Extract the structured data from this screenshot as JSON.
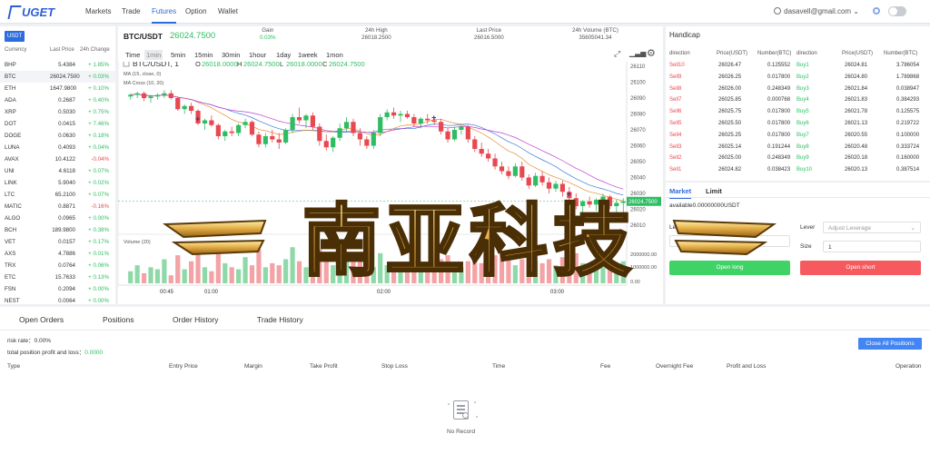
{
  "header": {
    "logo_text": "UGET",
    "nav": [
      "Markets",
      "Trade",
      "Futures",
      "Option",
      "Wallet"
    ],
    "active_nav": "Futures",
    "user_email": "dasavell@gmail.com"
  },
  "markets": {
    "tab": "USDT",
    "col_currency": "Currency",
    "col_last": "Last Price",
    "col_change": "24h Change",
    "rows": [
      {
        "currency": "BHP",
        "last": "5.4384",
        "change": "+ 1.85%",
        "dir": "up"
      },
      {
        "currency": "BTC",
        "last": "26024.7500",
        "change": "+ 0.03%",
        "dir": "up"
      },
      {
        "currency": "ETH",
        "last": "1647.9800",
        "change": "+ 0.10%",
        "dir": "up"
      },
      {
        "currency": "ADA",
        "last": "0.2687",
        "change": "+ 0.40%",
        "dir": "up"
      },
      {
        "currency": "XRP",
        "last": "0.5030",
        "change": "+ 0.75%",
        "dir": "up"
      },
      {
        "currency": "DOT",
        "last": "0.0415",
        "change": "+ 7.46%",
        "dir": "up"
      },
      {
        "currency": "DOGE",
        "last": "0.0630",
        "change": "+ 0.18%",
        "dir": "up"
      },
      {
        "currency": "LUNA",
        "last": "0.4093",
        "change": "+ 0.04%",
        "dir": "up"
      },
      {
        "currency": "AVAX",
        "last": "10.4122",
        "change": "-0.04%",
        "dir": "down"
      },
      {
        "currency": "UNI",
        "last": "4.6118",
        "change": "+ 0.07%",
        "dir": "up"
      },
      {
        "currency": "LINK",
        "last": "5.9040",
        "change": "+ 0.02%",
        "dir": "up"
      },
      {
        "currency": "LTC",
        "last": "65.2100",
        "change": "+ 0.07%",
        "dir": "up"
      },
      {
        "currency": "MATIC",
        "last": "0.8871",
        "change": "-0.16%",
        "dir": "down"
      },
      {
        "currency": "ALGO",
        "last": "0.0965",
        "change": "+ 0.00%",
        "dir": "up"
      },
      {
        "currency": "BCH",
        "last": "189.9800",
        "change": "+ 0.38%",
        "dir": "up"
      },
      {
        "currency": "VET",
        "last": "0.0157",
        "change": "+ 0.17%",
        "dir": "up"
      },
      {
        "currency": "AXS",
        "last": "4.7886",
        "change": "+ 0.01%",
        "dir": "up"
      },
      {
        "currency": "TRX",
        "last": "0.0764",
        "change": "+ 0.06%",
        "dir": "up"
      },
      {
        "currency": "ETC",
        "last": "15.7633",
        "change": "+ 0.13%",
        "dir": "up"
      },
      {
        "currency": "FSN",
        "last": "0.2094",
        "change": "+ 0.00%",
        "dir": "up"
      },
      {
        "currency": "NEST",
        "last": "0.0064",
        "change": "+ 0.00%",
        "dir": "up"
      }
    ]
  },
  "ticker": {
    "symbol": "BTC/USDT",
    "price": "26024.7500",
    "gain_label": "Gain",
    "gain_value": "0.03%",
    "high_label": "24h High",
    "high_value": "26018.2500",
    "last_label": "Last Price",
    "last_value": "26016.5000",
    "vol_label": "24h Volume (BTC)",
    "vol_value": "35605041.34"
  },
  "chart_toolbar": {
    "time_label": "Time",
    "intervals": [
      "1min",
      "5min",
      "15min",
      "30min",
      "1hour",
      "1day",
      "1week",
      "1mon"
    ],
    "active_interval": "1min"
  },
  "chart_data": {
    "type": "candlestick",
    "legend_symbol": "BTC/USDT, 1",
    "ohlc_labels": {
      "o": "26018.0000",
      "h": "26024.7500",
      "l": "26018.0000",
      "c": "26024.7500"
    },
    "ma_label": "MA (15, close, 0)",
    "ma_cross_label": "MA Cross (10, 20)",
    "volume_label": "Volume (20)",
    "ylim": [
      26010,
      26110
    ],
    "y_ticks": [
      26110,
      26100,
      26090,
      26080,
      26070,
      26060,
      26050,
      26040,
      26030,
      26020,
      26010
    ],
    "x_ticks": [
      "00:45",
      "01:00",
      "02:00",
      "03:00"
    ],
    "volume_ticks": [
      "2000000.00",
      "1000000.00",
      "0.00"
    ],
    "candles": [
      [
        26091,
        26093,
        26089,
        26092
      ],
      [
        26092,
        26094,
        26090,
        26093
      ],
      [
        26093,
        26094,
        26088,
        26090
      ],
      [
        26090,
        26092,
        26087,
        26091
      ],
      [
        26091,
        26093,
        26089,
        26092
      ],
      [
        26092,
        26095,
        26090,
        26093
      ],
      [
        26093,
        26095,
        26089,
        26090
      ],
      [
        26090,
        26091,
        26082,
        26083
      ],
      [
        26083,
        26086,
        26080,
        26085
      ],
      [
        26085,
        26087,
        26080,
        26082
      ],
      [
        26082,
        26083,
        26073,
        26074
      ],
      [
        26074,
        26077,
        26070,
        26076
      ],
      [
        26076,
        26079,
        26072,
        26073
      ],
      [
        26073,
        26074,
        26064,
        26066
      ],
      [
        26066,
        26070,
        26063,
        26069
      ],
      [
        26069,
        26072,
        26066,
        26068
      ],
      [
        26068,
        26074,
        26066,
        26073
      ],
      [
        26073,
        26077,
        26071,
        26075
      ],
      [
        26075,
        26076,
        26066,
        26067
      ],
      [
        26067,
        26069,
        26059,
        26061
      ],
      [
        26061,
        26068,
        26059,
        26066
      ],
      [
        26066,
        26070,
        26062,
        26064
      ],
      [
        26064,
        26068,
        26058,
        26062
      ],
      [
        26062,
        26071,
        26061,
        26070
      ],
      [
        26070,
        26080,
        26068,
        26078
      ],
      [
        26078,
        26084,
        26074,
        26076
      ],
      [
        26076,
        26080,
        26071,
        26079
      ],
      [
        26079,
        26081,
        26070,
        26072
      ],
      [
        26072,
        26074,
        26060,
        26063
      ],
      [
        26063,
        26067,
        26057,
        26059
      ],
      [
        26059,
        26066,
        26056,
        26065
      ],
      [
        26065,
        26074,
        26063,
        26071
      ],
      [
        26071,
        26078,
        26069,
        26075
      ],
      [
        26075,
        26077,
        26066,
        26068
      ],
      [
        26068,
        26071,
        26060,
        26064
      ],
      [
        26064,
        26066,
        26058,
        26060
      ],
      [
        26060,
        26070,
        26058,
        26068
      ],
      [
        26068,
        26080,
        26066,
        26078
      ],
      [
        26078,
        26083,
        26076,
        26081
      ],
      [
        26081,
        26084,
        26077,
        26079
      ],
      [
        26079,
        26082,
        26075,
        26080
      ],
      [
        26080,
        26082,
        26077,
        26078
      ],
      [
        26078,
        26080,
        26072,
        26074
      ],
      [
        26074,
        26078,
        26071,
        26077
      ],
      [
        26077,
        26080,
        26074,
        26076
      ],
      [
        26076,
        26078,
        26073,
        26075
      ],
      [
        26075,
        26077,
        26067,
        26069
      ],
      [
        26069,
        26071,
        26062,
        26064
      ],
      [
        26064,
        26072,
        26063,
        26070
      ],
      [
        26070,
        26074,
        26067,
        26072
      ],
      [
        26072,
        26073,
        26062,
        26064
      ],
      [
        26064,
        26066,
        26056,
        26058
      ],
      [
        26058,
        26062,
        26053,
        26055
      ],
      [
        26055,
        26058,
        26050,
        26052
      ],
      [
        26052,
        26055,
        26045,
        26047
      ],
      [
        26047,
        26050,
        26042,
        26044
      ],
      [
        26044,
        26047,
        26039,
        26041
      ],
      [
        26041,
        26049,
        26040,
        26047
      ],
      [
        26047,
        26050,
        26038,
        26040
      ],
      [
        26040,
        26042,
        26033,
        26035
      ],
      [
        26035,
        26043,
        26034,
        26041
      ],
      [
        26041,
        26044,
        26035,
        26037
      ],
      [
        26037,
        26040,
        26030,
        26033
      ],
      [
        26033,
        26038,
        26031,
        26036
      ],
      [
        26036,
        26038,
        26028,
        26031
      ],
      [
        26031,
        26034,
        26024,
        26027
      ],
      [
        26027,
        26030,
        26020,
        26022
      ],
      [
        26022,
        26026,
        26018,
        26025
      ],
      [
        26025,
        26028,
        26021,
        26023
      ],
      [
        26023,
        26027,
        26019,
        26026
      ],
      [
        26026,
        26030,
        26022,
        26028
      ],
      [
        26028,
        26029,
        26020,
        26022
      ],
      [
        26022,
        26026,
        26018,
        26024
      ],
      [
        26024,
        26027,
        26018,
        26025
      ]
    ],
    "volumes": [
      30,
      45,
      25,
      40,
      35,
      60,
      20,
      70,
      35,
      55,
      80,
      40,
      30,
      95,
      50,
      40,
      35,
      65,
      45,
      85,
      40,
      50,
      45,
      60,
      90,
      55,
      40,
      70,
      85,
      60,
      45,
      50,
      55,
      65,
      70,
      50,
      40,
      75,
      45,
      35,
      30,
      40,
      55,
      35,
      30,
      40,
      60,
      70,
      45,
      40,
      55,
      65,
      50,
      60,
      70,
      75,
      65,
      45,
      60,
      70,
      55,
      50,
      60,
      45,
      65,
      70,
      75,
      50,
      40,
      45,
      40,
      50,
      45,
      55
    ],
    "markers": [
      {
        "i": 10,
        "label": "+"
      },
      {
        "i": 45,
        "label": "+"
      },
      {
        "i": 65,
        "label": "+"
      }
    ]
  },
  "handicap": {
    "title": "Handicap",
    "headers": [
      "direction",
      "Price(USDT)",
      "Number(BTC)",
      "direction",
      "Price(USDT)",
      "Number(BTC)"
    ],
    "sells": [
      {
        "label": "Sell10",
        "price": "26026.47",
        "num": "0.125552"
      },
      {
        "label": "Sell9",
        "price": "26026.25",
        "num": "0.017800"
      },
      {
        "label": "Sell8",
        "price": "26026.00",
        "num": "0.248349"
      },
      {
        "label": "Sell7",
        "price": "26025.85",
        "num": "0.000768"
      },
      {
        "label": "Sell6",
        "price": "26025.75",
        "num": "0.017800"
      },
      {
        "label": "Sell5",
        "price": "26025.50",
        "num": "0.017800"
      },
      {
        "label": "Sell4",
        "price": "26025.25",
        "num": "0.017800"
      },
      {
        "label": "Sell3",
        "price": "26025.14",
        "num": "0.191244"
      },
      {
        "label": "Sell2",
        "price": "26025.00",
        "num": "0.248349"
      },
      {
        "label": "Sell1",
        "price": "26024.82",
        "num": "0.038423"
      }
    ],
    "buys": [
      {
        "label": "Buy1",
        "price": "26024.81",
        "num": "3.786054"
      },
      {
        "label": "Buy2",
        "price": "26024.80",
        "num": "1.789868"
      },
      {
        "label": "Buy3",
        "price": "26021.84",
        "num": "0.038947"
      },
      {
        "label": "Buy4",
        "price": "26021.83",
        "num": "0.384293"
      },
      {
        "label": "Buy5",
        "price": "26021.78",
        "num": "0.125575"
      },
      {
        "label": "Buy6",
        "price": "26021.13",
        "num": "0.219722"
      },
      {
        "label": "Buy7",
        "price": "26020.55",
        "num": "0.100000"
      },
      {
        "label": "Buy8",
        "price": "26020.48",
        "num": "0.333724"
      },
      {
        "label": "Buy9",
        "price": "26020.18",
        "num": "0.160000"
      },
      {
        "label": "Buy10",
        "price": "26020.13",
        "num": "0.387514"
      }
    ]
  },
  "trade_form": {
    "tab_market": "Market",
    "tab_limit": "Limit",
    "available": "available0.00000000USDT",
    "lever_label": "Lever",
    "lever_placeholder": "Adjust Leverage",
    "size_label": "Size",
    "size_value": "1",
    "open_long": "Open long",
    "open_short": "Open short"
  },
  "orders": {
    "tabs": [
      "Open Orders",
      "Positions",
      "Order History",
      "Trade History"
    ],
    "risk_rate": "risk rate：0.00%",
    "total_pl_label": "total position profit and loss：",
    "total_pl_value": "0.0000",
    "close_all": "Close All Positions",
    "columns": [
      "Type",
      "Entry Price",
      "Margin",
      "Take Profit",
      "Stop Loss",
      "Time",
      "Fee",
      "Overnight Fee",
      "Profit and Loss",
      "Operation"
    ],
    "empty_text": "No Record"
  },
  "watermark": {
    "text": "南亚科技"
  },
  "colors": {
    "up": "#2fbd63",
    "down": "#e8484f",
    "accent": "#2d6cdf",
    "long_btn": "#3fd366",
    "short_btn": "#f65a5f"
  }
}
